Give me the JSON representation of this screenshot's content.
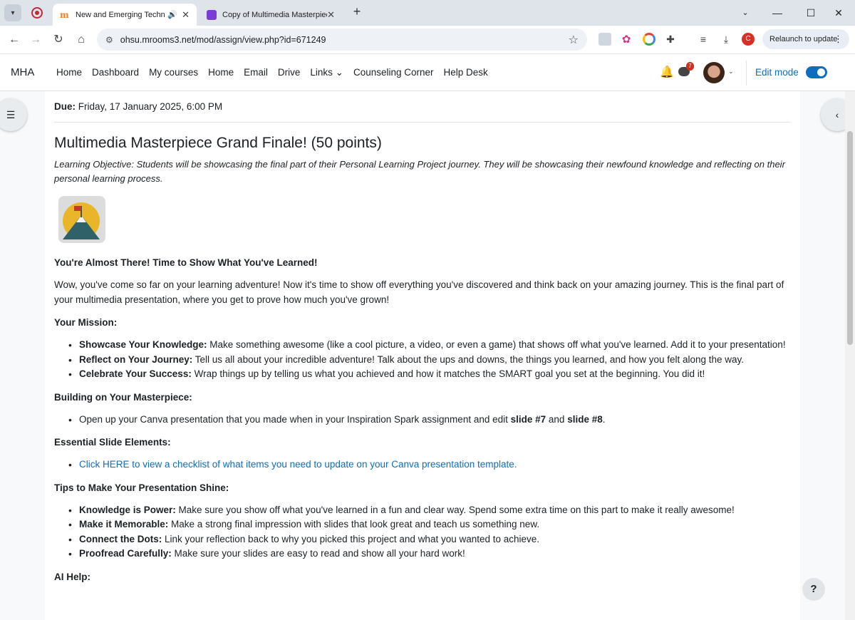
{
  "browser": {
    "tabs": [
      {
        "title": "New and Emerging Technol",
        "active": true
      },
      {
        "title": "Copy of Multimedia Masterpiec",
        "active": false
      }
    ],
    "new_tab": "+",
    "url": "ohsu.mrooms3.net/mod/assign/view.php?id=671249",
    "relaunch_label": "Relaunch to update",
    "profile_letter": "C",
    "window_controls": {
      "minimize": "—",
      "maximize": "☐",
      "close": "✕"
    }
  },
  "navbar": {
    "brand": "MHA",
    "links": [
      "Home",
      "Dashboard",
      "My courses",
      "Home",
      "Email",
      "Drive",
      "Links ⌄",
      "Counseling Corner",
      "Help Desk"
    ],
    "message_count": "7",
    "edit_mode_label": "Edit mode",
    "edit_mode_on": true
  },
  "assignment": {
    "due_label": "Due:",
    "due_value": " Friday, 17 January 2025, 6:00 PM",
    "title": "Multimedia Masterpiece Grand Finale! (50 points)",
    "objective": "Learning Objective: Students will be showcasing the final part of their Personal Learning Project journey. They will be showcasing their newfound knowledge and reflecting on their personal learning process.",
    "almost_heading": "You're Almost There! Time to Show What You've Learned!",
    "intro": "Wow, you've come so far on your learning adventure! Now it's time to show off everything you've discovered and think back on your amazing journey. This is the final part of your multimedia presentation, where you get to prove how much you've grown!",
    "mission_heading": "Your Mission:",
    "mission_items": [
      {
        "bold": "Showcase Your Knowledge:",
        "text": " Make something awesome (like a cool picture, a video, or even a game) that shows off what you've learned. Add it to your presentation!"
      },
      {
        "bold": "Reflect on Your Journey:",
        "text": " Tell us all about your incredible adventure! Talk about the ups and downs, the things you learned, and how you felt along the way."
      },
      {
        "bold": "Celebrate Your Success:",
        "text": " Wrap things up by telling us what you achieved and how it matches the SMART goal you set at the beginning. You did it!"
      }
    ],
    "building_heading": "Building on Your Masterpiece:",
    "building_item": {
      "text1": "Open up your Canva presentation that you made when in your Inspiration Spark assignment and edit ",
      "bold1": "slide #7",
      "text2": " and ",
      "bold2": "slide #8",
      "text3": "."
    },
    "elements_heading": "Essential Slide Elements:",
    "elements_link": "Click HERE to view a checklist of what items you need to update on your Canva presentation template.",
    "tips_heading": "Tips to Make Your Presentation Shine:",
    "tips_items": [
      {
        "bold": "Knowledge is Power:",
        "text": " Make sure you show off what you've learned in a fun and clear way. Spend some extra time on this part to make it really awesome!"
      },
      {
        "bold": "Make it Memorable:",
        "text": " Make a strong final impression with slides that look great and teach us something new."
      },
      {
        "bold": "Connect the Dots:",
        "text": " Link your reflection back to why you picked this project and what you wanted to achieve."
      },
      {
        "bold": "Proofread Carefully:",
        "text": " Make sure your slides are easy to read and show all your hard work!"
      }
    ],
    "ai_heading": "AI Help:"
  },
  "help_button": "?",
  "colors": {
    "link": "#0f6cbf",
    "toggle": "#0f6cbf",
    "badge": "#ca3120"
  }
}
